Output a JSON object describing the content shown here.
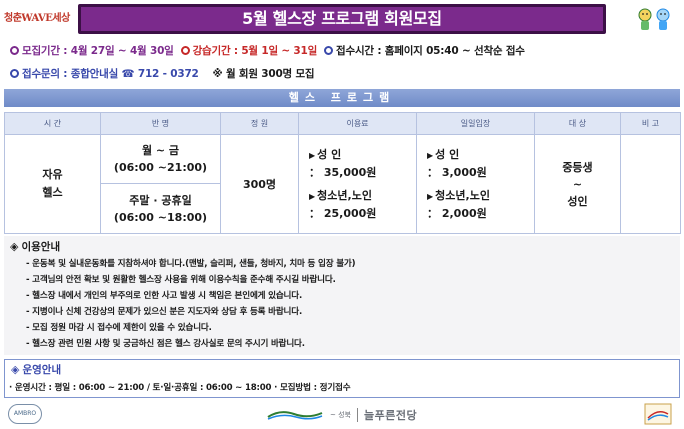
{
  "header": {
    "logo_text": "청춘WAVE세상",
    "title": "5월 헬스장 프로그램 회원모집"
  },
  "info": {
    "recruit_label": "모집기간 : ",
    "recruit_value": "4월 27일 ~ 4월 30일",
    "class_label": "강습기간 : ",
    "class_value": "5월 1일 ~ 31일",
    "apply_text": "접수시간 : 홈페이지 05:40 ~ 선착순 접수",
    "inquiry_text": "접수문의 : 종합안내실 ☎ 712 - 0372",
    "note_text": "※ 월 회원 300명 모집"
  },
  "section_title": "헬스 프로그램",
  "table": {
    "headers": [
      "시 간",
      "반 명",
      "정 원",
      "이용료",
      "일일입장",
      "대 상",
      "비 고"
    ],
    "time_label_1": "자유",
    "time_label_2": "헬스",
    "weekday_label": "월 ~ 금",
    "weekday_hours": "(06:00 ~21:00)",
    "weekend_label": "주말 · 공휴일",
    "weekend_hours": "(06:00 ~18:00)",
    "capacity": "300명",
    "fee_adult_label": "성   인",
    "fee_adult_value": "： 35,000원",
    "fee_youth_label": "청소년,노인",
    "fee_youth_value": "： 25,000원",
    "daily_adult_label": "성   인",
    "daily_adult_value": "： 3,000원",
    "daily_youth_label": "청소년,노인",
    "daily_youth_value": "： 2,000원",
    "target_1": "중등생",
    "target_2": "~",
    "target_3": "성인",
    "remarks": ""
  },
  "notice": {
    "title": "이용안내",
    "items": [
      "- 운동복 및 실내운동화를 지참하셔야 합니다.(맨발, 슬리퍼, 샌들, 청바지, 치마 등 입장 불가)",
      "- 고객님의 안전 확보 및 원활한 헬스장 사용을 위해 이용수칙을 준수해 주시길 바랍니다.",
      "- 헬스장 내에서 개인의 부주의로 인한 사고 발생 시 책임은 본인에게 있습니다.",
      "- 지병이나 신체 건강상의 문제가 있으신 분은 지도자와 상담 후 등록 바랍니다.",
      "- 모집 정원 마감 시 접수에 제한이 있을 수 있습니다.",
      "- 헬스장 관련 민원 사항 및 궁금하신 점은 헬스 강사실로 문의 주시기 바랍니다."
    ]
  },
  "operation": {
    "title": "운영안내",
    "line": "· 운영시간 : 평일 : 06:00 ~ 21:00 / 토·일·공휴일 : 06:00 ~ 18:00   · 모집방법 : 정기접수"
  },
  "footer": {
    "emblem_text": "AMBRO",
    "org_small": "~ 성북",
    "org_name": "늘푸른전당"
  },
  "colors": {
    "title_bg": "#7b2a8c",
    "accent_purple": "#7b2a8c",
    "accent_red": "#c62828",
    "accent_blue": "#3949ab",
    "section_bar": "#7f95cf"
  }
}
